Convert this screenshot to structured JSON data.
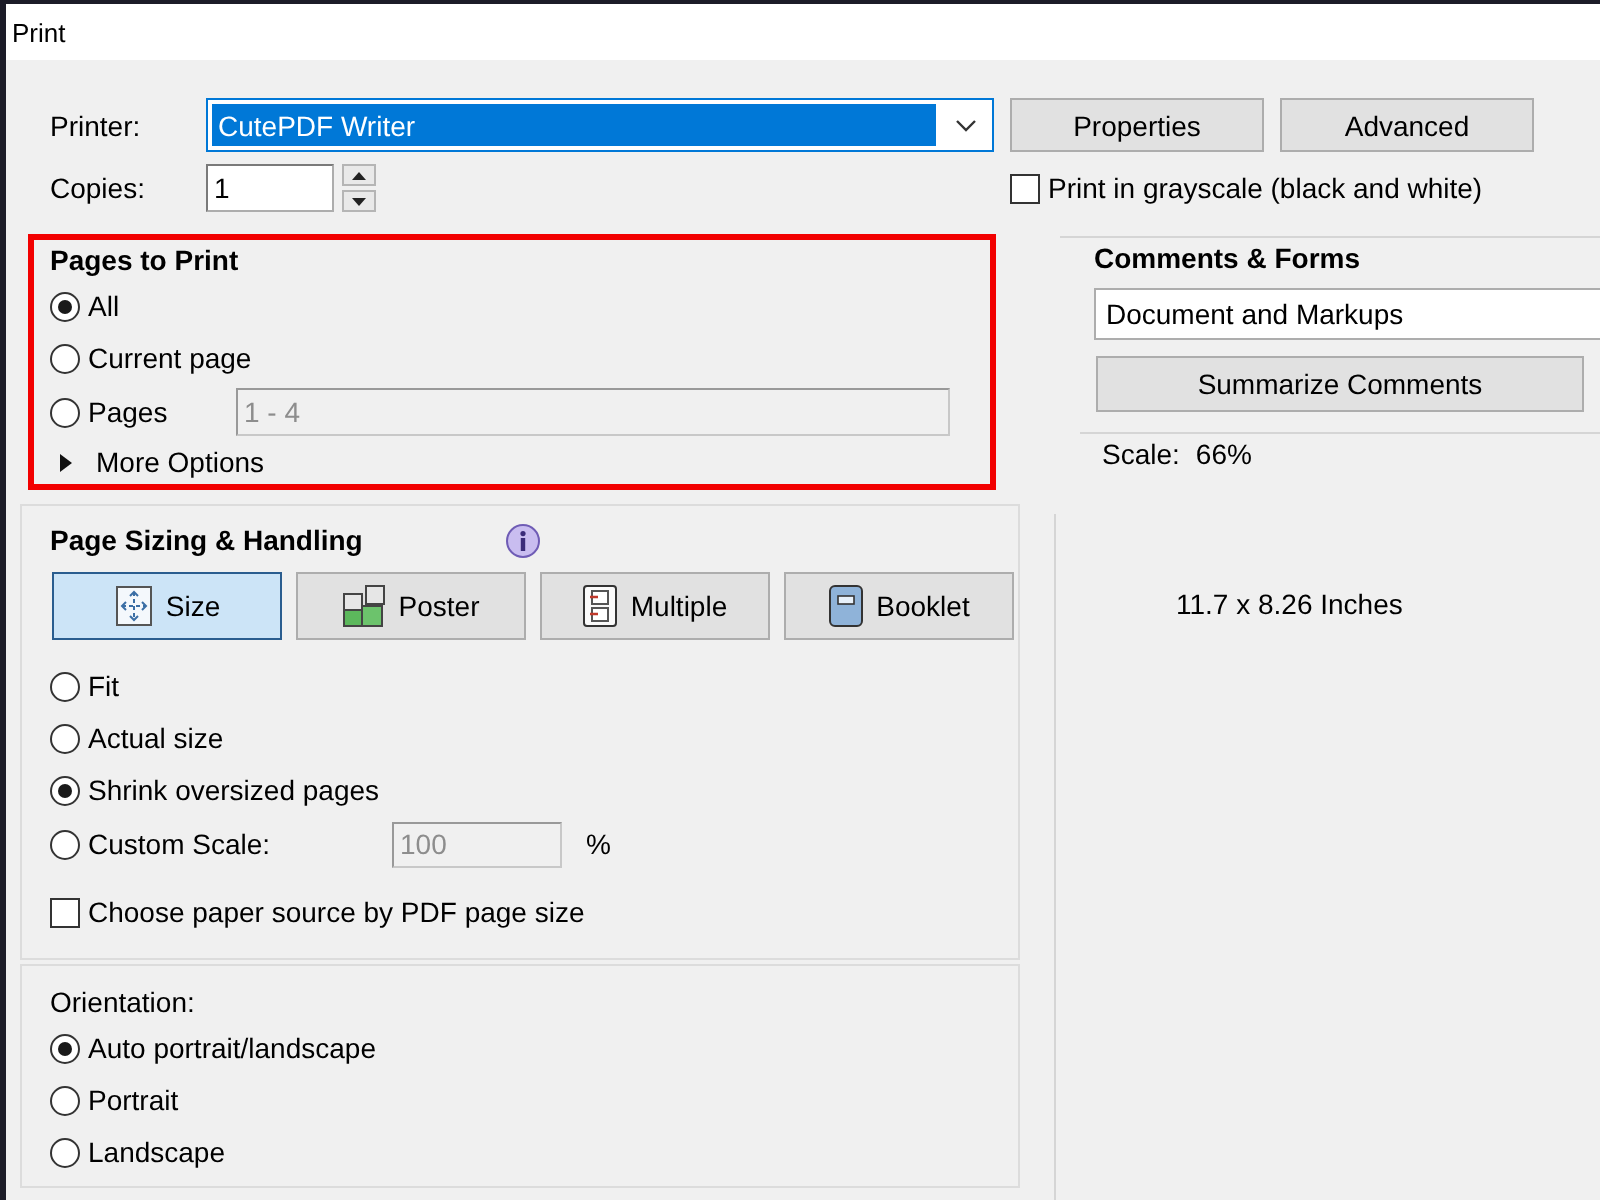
{
  "window": {
    "title": "Print"
  },
  "printer": {
    "label": "Printer:",
    "value": "CutePDF Writer",
    "focused": true,
    "buttons": [
      "Properties",
      "Advanced"
    ]
  },
  "copies": {
    "label": "Copies:",
    "value": "1"
  },
  "grayscale": {
    "label": "Print in grayscale (black and white)",
    "checked": false
  },
  "pages_to_print": {
    "title": "Pages to Print",
    "highlighted": true,
    "options": [
      {
        "label": "All",
        "selected": true
      },
      {
        "label": "Current page",
        "selected": false
      },
      {
        "label": "Pages",
        "selected": false,
        "field": {
          "value": "1 - 4",
          "disabled": true
        }
      }
    ],
    "more_options": {
      "label": "More Options",
      "expanded": false
    }
  },
  "comments_and_forms": {
    "title": "Comments & Forms",
    "value": "Document and Markups",
    "button": "Summarize Comments",
    "scale_label": "Scale:",
    "scale_value": "66%"
  },
  "page_sizing": {
    "title": "Page Sizing & Handling",
    "modes": [
      {
        "kind": "size",
        "label": "Size",
        "selected": true
      },
      {
        "kind": "poster",
        "label": "Poster",
        "selected": false
      },
      {
        "kind": "multiple",
        "label": "Multiple",
        "selected": false
      },
      {
        "kind": "booklet",
        "label": "Booklet",
        "selected": false
      }
    ],
    "options": [
      {
        "label": "Fit",
        "selected": false
      },
      {
        "label": "Actual size",
        "selected": false
      },
      {
        "label": "Shrink oversized pages",
        "selected": true
      },
      {
        "label": "Custom Scale:",
        "selected": false,
        "field": {
          "value": "100",
          "disabled": true,
          "unit": "%"
        }
      }
    ],
    "paper_source": {
      "label": "Choose paper source by PDF page size",
      "checked": false
    }
  },
  "preview": {
    "paper_size": "11.7 x 8.26 Inches"
  },
  "orientation": {
    "title": "Orientation:",
    "options": [
      {
        "label": "Auto portrait/landscape",
        "selected": true
      },
      {
        "label": "Portrait",
        "selected": false
      },
      {
        "label": "Landscape",
        "selected": false
      }
    ]
  }
}
